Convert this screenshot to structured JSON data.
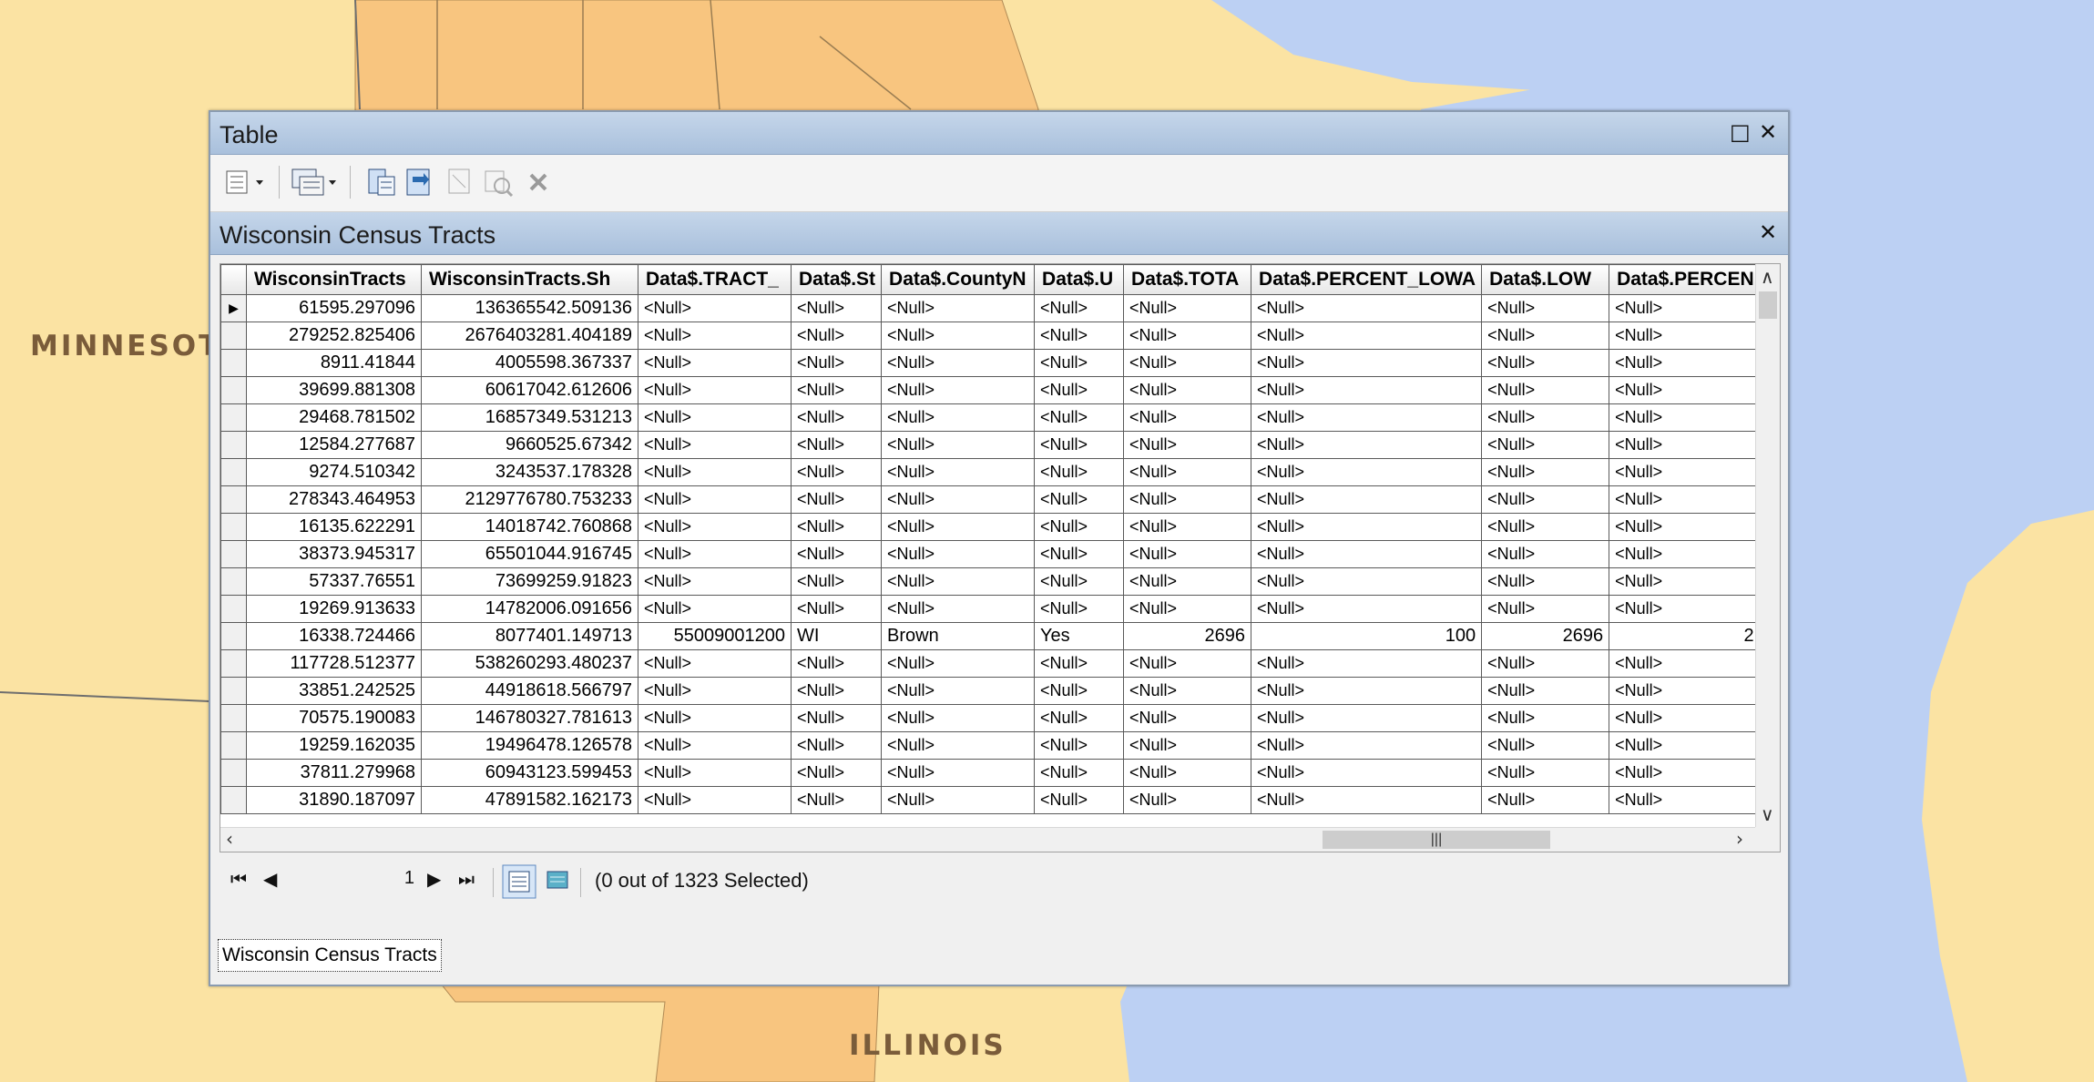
{
  "map": {
    "labels": {
      "minnesota": "MINNESOT",
      "illinois": "ILLINOIS"
    },
    "colors": {
      "land": "#fbe3a3",
      "wisconsin": "#f8c57f",
      "lake": "#bcd0f3",
      "border": "#8a7a5a"
    }
  },
  "window": {
    "title": "Table",
    "maximize_icon": "maximize-icon",
    "close_icon": "close-icon"
  },
  "toolbar": {
    "icons": [
      "table-options-icon",
      "related-tables-icon",
      "select-by-attributes-icon",
      "switch-selection-icon",
      "clear-selection-icon",
      "zoom-to-selected-icon",
      "delete-selected-icon"
    ]
  },
  "table_tab": {
    "title": "Wisconsin Census Tracts"
  },
  "grid": {
    "headers": [
      "WisconsinTracts",
      "WisconsinTracts.Sh",
      "Data$.TRACT_",
      "Data$.St",
      "Data$.CountyN",
      "Data$.U",
      "Data$.TOTA",
      "Data$.PERCENT_LOWA",
      "Data$.LOW",
      "Data$.PERCEN"
    ],
    "rows": [
      [
        "61595.297096",
        "136365542.509136",
        "<Null>",
        "<Null>",
        "<Null>",
        "<Null>",
        "<Null>",
        "<Null>",
        "<Null>",
        "<Null>"
      ],
      [
        "279252.825406",
        "2676403281.404189",
        "<Null>",
        "<Null>",
        "<Null>",
        "<Null>",
        "<Null>",
        "<Null>",
        "<Null>",
        "<Null>"
      ],
      [
        "8911.41844",
        "4005598.367337",
        "<Null>",
        "<Null>",
        "<Null>",
        "<Null>",
        "<Null>",
        "<Null>",
        "<Null>",
        "<Null>"
      ],
      [
        "39699.881308",
        "60617042.612606",
        "<Null>",
        "<Null>",
        "<Null>",
        "<Null>",
        "<Null>",
        "<Null>",
        "<Null>",
        "<Null>"
      ],
      [
        "29468.781502",
        "16857349.531213",
        "<Null>",
        "<Null>",
        "<Null>",
        "<Null>",
        "<Null>",
        "<Null>",
        "<Null>",
        "<Null>"
      ],
      [
        "12584.277687",
        "9660525.67342",
        "<Null>",
        "<Null>",
        "<Null>",
        "<Null>",
        "<Null>",
        "<Null>",
        "<Null>",
        "<Null>"
      ],
      [
        "9274.510342",
        "3243537.178328",
        "<Null>",
        "<Null>",
        "<Null>",
        "<Null>",
        "<Null>",
        "<Null>",
        "<Null>",
        "<Null>"
      ],
      [
        "278343.464953",
        "2129776780.753233",
        "<Null>",
        "<Null>",
        "<Null>",
        "<Null>",
        "<Null>",
        "<Null>",
        "<Null>",
        "<Null>"
      ],
      [
        "16135.622291",
        "14018742.760868",
        "<Null>",
        "<Null>",
        "<Null>",
        "<Null>",
        "<Null>",
        "<Null>",
        "<Null>",
        "<Null>"
      ],
      [
        "38373.945317",
        "65501044.916745",
        "<Null>",
        "<Null>",
        "<Null>",
        "<Null>",
        "<Null>",
        "<Null>",
        "<Null>",
        "<Null>"
      ],
      [
        "57337.76551",
        "73699259.91823",
        "<Null>",
        "<Null>",
        "<Null>",
        "<Null>",
        "<Null>",
        "<Null>",
        "<Null>",
        "<Null>"
      ],
      [
        "19269.913633",
        "14782006.091656",
        "<Null>",
        "<Null>",
        "<Null>",
        "<Null>",
        "<Null>",
        "<Null>",
        "<Null>",
        "<Null>"
      ],
      [
        "16338.724466",
        "8077401.149713",
        "55009001200",
        "WI",
        "Brown",
        "Yes",
        "2696",
        "100",
        "2696",
        "2"
      ],
      [
        "117728.512377",
        "538260293.480237",
        "<Null>",
        "<Null>",
        "<Null>",
        "<Null>",
        "<Null>",
        "<Null>",
        "<Null>",
        "<Null>"
      ],
      [
        "33851.242525",
        "44918618.566797",
        "<Null>",
        "<Null>",
        "<Null>",
        "<Null>",
        "<Null>",
        "<Null>",
        "<Null>",
        "<Null>"
      ],
      [
        "70575.190083",
        "146780327.781613",
        "<Null>",
        "<Null>",
        "<Null>",
        "<Null>",
        "<Null>",
        "<Null>",
        "<Null>",
        "<Null>"
      ],
      [
        "19259.162035",
        "19496478.126578",
        "<Null>",
        "<Null>",
        "<Null>",
        "<Null>",
        "<Null>",
        "<Null>",
        "<Null>",
        "<Null>"
      ],
      [
        "37811.279968",
        "60943123.599453",
        "<Null>",
        "<Null>",
        "<Null>",
        "<Null>",
        "<Null>",
        "<Null>",
        "<Null>",
        "<Null>"
      ],
      [
        "31890.187097",
        "47891582.162173",
        "<Null>",
        "<Null>",
        "<Null>",
        "<Null>",
        "<Null>",
        "<Null>",
        "<Null>",
        "<Null>"
      ]
    ],
    "current_row": 0
  },
  "navigation": {
    "record": "1",
    "selection_status": "(0 out of 1323 Selected)"
  },
  "bottom_tab": {
    "label": "Wisconsin Census Tracts"
  }
}
